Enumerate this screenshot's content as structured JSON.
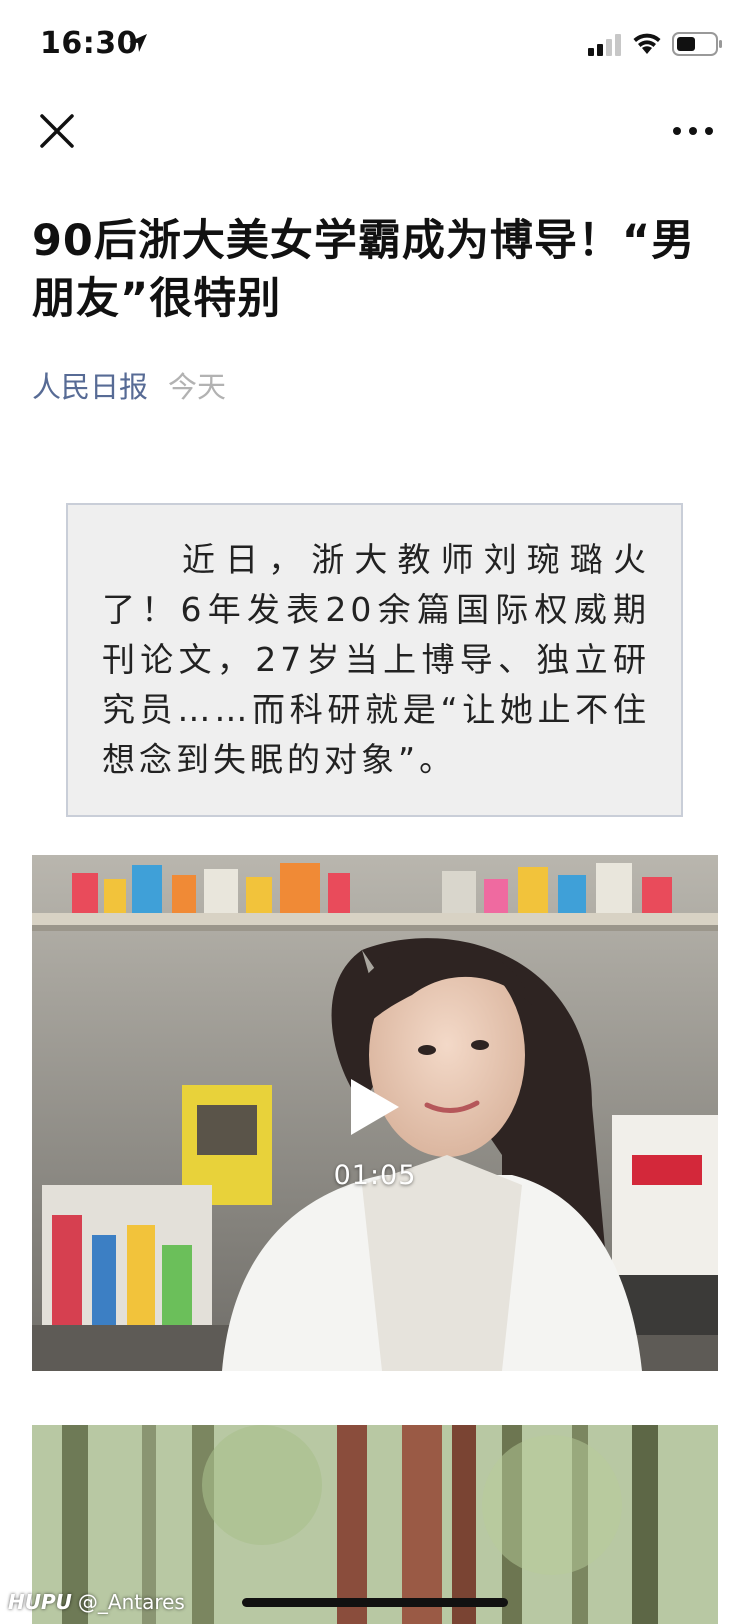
{
  "status": {
    "time": "16:30"
  },
  "nav": {
    "close_icon": "close-icon",
    "more_icon": "more-dots-icon"
  },
  "article": {
    "title": "90后浙大美女学霸成为博导！“男朋友”很特别",
    "source": "人民日报",
    "date": "今天",
    "summary": "近日，浙大教师刘琬璐火了！6年发表20余篇国际权威期刊论文，27岁当上博导、独立研究员……而科研就是“让她止不住想念到失眠的对象”。"
  },
  "video": {
    "duration": "01:05",
    "play_icon": "play-icon"
  },
  "watermark": {
    "brand": "HUPU",
    "user": "@_Antares"
  },
  "colors": {
    "link": "#576b95",
    "muted": "#b2b2b2",
    "box_bg": "#efefef",
    "box_border": "#c9ced8"
  }
}
